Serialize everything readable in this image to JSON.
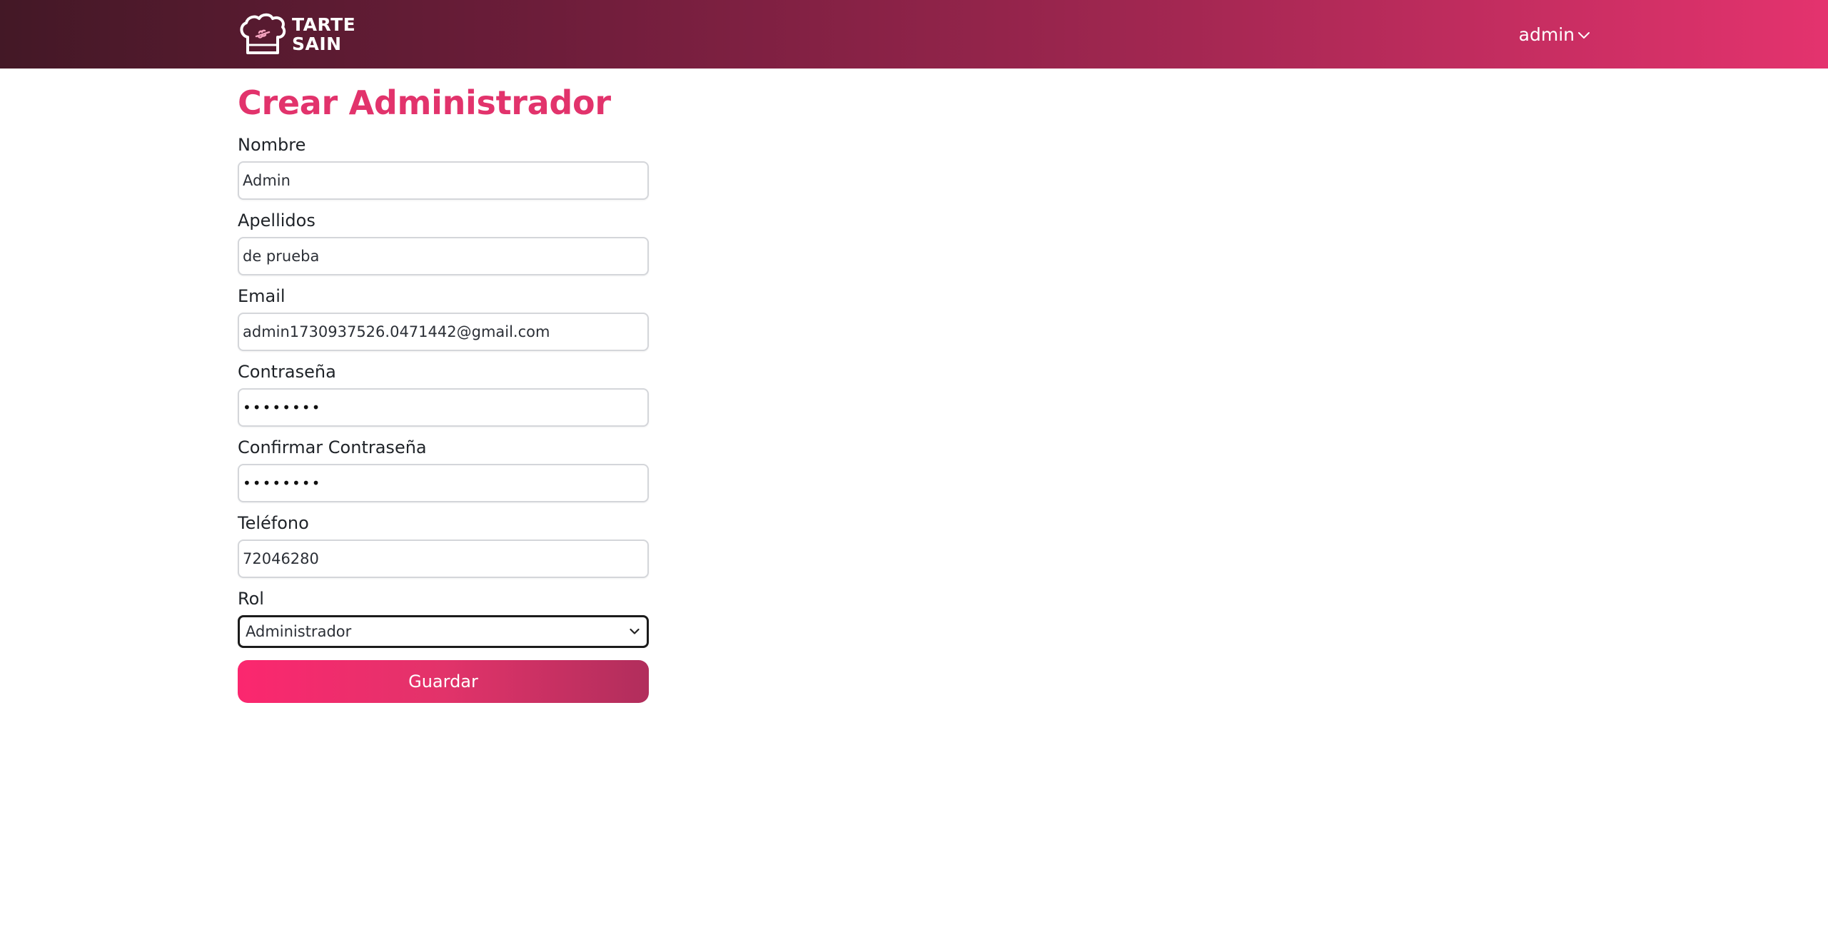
{
  "header": {
    "brand_line1": "TARTE",
    "brand_line2": "SAIN",
    "brand_logo_icon": "chef-hat-icon",
    "user_label": "admin",
    "user_menu_icon": "chevron-down-icon",
    "gradient_start": "#431826",
    "gradient_end": "#e4336e"
  },
  "page": {
    "title": "Crear Administrador",
    "title_color": "#e2336c"
  },
  "form": {
    "nombre": {
      "label": "Nombre",
      "value": "Admin"
    },
    "apellidos": {
      "label": "Apellidos",
      "value": "de prueba"
    },
    "email": {
      "label": "Email",
      "value": "admin1730937526.0471442@gmail.com"
    },
    "password": {
      "label": "Contraseña",
      "value": "••••••••"
    },
    "confirm_password": {
      "label": "Confirmar Contraseña",
      "value": "••••••••"
    },
    "telefono": {
      "label": "Teléfono",
      "value": "72046280"
    },
    "rol": {
      "label": "Rol",
      "selected": "Administrador"
    },
    "save_label": "Guardar",
    "button_gradient_start": "#fb276f",
    "button_gradient_end": "#b12e5c"
  }
}
